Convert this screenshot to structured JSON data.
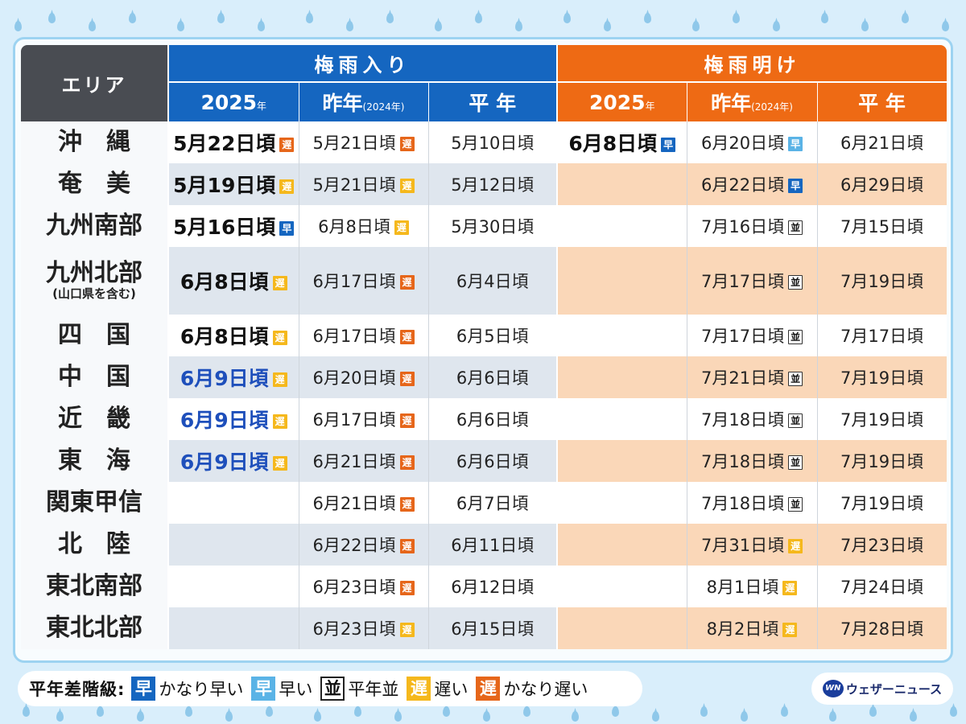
{
  "header": {
    "area": "エリア",
    "entry_label": "梅雨入り",
    "exit_label": "梅雨明け",
    "year_main": "2025",
    "year_suffix": "年",
    "last_year": "昨年",
    "last_year_paren": "(2024年)",
    "normal": "平 年"
  },
  "rows": [
    {
      "area": "沖　縄",
      "area_sub": "",
      "in_2025": "5月22日頃",
      "in_2025_badge": "遅",
      "in_2025_badge_class": "b-ka-oso",
      "in_2025_color": "black",
      "in_2024": "5月21日頃",
      "in_2024_badge": "遅",
      "in_2024_badge_class": "b-ka-oso",
      "in_normal": "5月10日頃",
      "out_2025": "6月8日頃",
      "out_2025_badge": "早",
      "out_2025_badge_class": "b-ka-haya",
      "out_2024": "6月20日頃",
      "out_2024_badge": "早",
      "out_2024_badge_class": "b-haya",
      "out_normal": "6月21日頃"
    },
    {
      "area": "奄　美",
      "area_sub": "",
      "in_2025": "5月19日頃",
      "in_2025_badge": "遅",
      "in_2025_badge_class": "b-oso",
      "in_2025_color": "black",
      "in_2024": "5月21日頃",
      "in_2024_badge": "遅",
      "in_2024_badge_class": "b-oso",
      "in_normal": "5月12日頃",
      "out_2025": "",
      "out_2025_badge": "",
      "out_2025_badge_class": "",
      "out_2024": "6月22日頃",
      "out_2024_badge": "早",
      "out_2024_badge_class": "b-ka-haya",
      "out_normal": "6月29日頃"
    },
    {
      "area": "九州南部",
      "area_sub": "",
      "in_2025": "5月16日頃",
      "in_2025_badge": "早",
      "in_2025_badge_class": "b-ka-haya",
      "in_2025_color": "black",
      "in_2024": "6月8日頃",
      "in_2024_badge": "遅",
      "in_2024_badge_class": "b-oso",
      "in_normal": "5月30日頃",
      "out_2025": "",
      "out_2025_badge": "",
      "out_2025_badge_class": "",
      "out_2024": "7月16日頃",
      "out_2024_badge": "並",
      "out_2024_badge_class": "b-nami",
      "out_normal": "7月15日頃"
    },
    {
      "area": "九州北部",
      "area_sub": "(山口県を含む)",
      "in_2025": "6月8日頃",
      "in_2025_badge": "遅",
      "in_2025_badge_class": "b-oso",
      "in_2025_color": "black",
      "in_2024": "6月17日頃",
      "in_2024_badge": "遅",
      "in_2024_badge_class": "b-ka-oso",
      "in_normal": "6月4日頃",
      "out_2025": "",
      "out_2025_badge": "",
      "out_2025_badge_class": "",
      "out_2024": "7月17日頃",
      "out_2024_badge": "並",
      "out_2024_badge_class": "b-nami",
      "out_normal": "7月19日頃"
    },
    {
      "area": "四　国",
      "area_sub": "",
      "in_2025": "6月8日頃",
      "in_2025_badge": "遅",
      "in_2025_badge_class": "b-oso",
      "in_2025_color": "black",
      "in_2024": "6月17日頃",
      "in_2024_badge": "遅",
      "in_2024_badge_class": "b-ka-oso",
      "in_normal": "6月5日頃",
      "out_2025": "",
      "out_2025_badge": "",
      "out_2025_badge_class": "",
      "out_2024": "7月17日頃",
      "out_2024_badge": "並",
      "out_2024_badge_class": "b-nami",
      "out_normal": "7月17日頃"
    },
    {
      "area": "中　国",
      "area_sub": "",
      "in_2025": "6月9日頃",
      "in_2025_badge": "遅",
      "in_2025_badge_class": "b-oso",
      "in_2025_color": "blue",
      "in_2024": "6月20日頃",
      "in_2024_badge": "遅",
      "in_2024_badge_class": "b-ka-oso",
      "in_normal": "6月6日頃",
      "out_2025": "",
      "out_2025_badge": "",
      "out_2025_badge_class": "",
      "out_2024": "7月21日頃",
      "out_2024_badge": "並",
      "out_2024_badge_class": "b-nami",
      "out_normal": "7月19日頃"
    },
    {
      "area": "近　畿",
      "area_sub": "",
      "in_2025": "6月9日頃",
      "in_2025_badge": "遅",
      "in_2025_badge_class": "b-oso",
      "in_2025_color": "blue",
      "in_2024": "6月17日頃",
      "in_2024_badge": "遅",
      "in_2024_badge_class": "b-ka-oso",
      "in_normal": "6月6日頃",
      "out_2025": "",
      "out_2025_badge": "",
      "out_2025_badge_class": "",
      "out_2024": "7月18日頃",
      "out_2024_badge": "並",
      "out_2024_badge_class": "b-nami",
      "out_normal": "7月19日頃"
    },
    {
      "area": "東　海",
      "area_sub": "",
      "in_2025": "6月9日頃",
      "in_2025_badge": "遅",
      "in_2025_badge_class": "b-oso",
      "in_2025_color": "blue",
      "in_2024": "6月21日頃",
      "in_2024_badge": "遅",
      "in_2024_badge_class": "b-ka-oso",
      "in_normal": "6月6日頃",
      "out_2025": "",
      "out_2025_badge": "",
      "out_2025_badge_class": "",
      "out_2024": "7月18日頃",
      "out_2024_badge": "並",
      "out_2024_badge_class": "b-nami",
      "out_normal": "7月19日頃"
    },
    {
      "area": "関東甲信",
      "area_sub": "",
      "in_2025": "",
      "in_2025_badge": "",
      "in_2025_badge_class": "",
      "in_2025_color": "black",
      "in_2024": "6月21日頃",
      "in_2024_badge": "遅",
      "in_2024_badge_class": "b-ka-oso",
      "in_normal": "6月7日頃",
      "out_2025": "",
      "out_2025_badge": "",
      "out_2025_badge_class": "",
      "out_2024": "7月18日頃",
      "out_2024_badge": "並",
      "out_2024_badge_class": "b-nami",
      "out_normal": "7月19日頃"
    },
    {
      "area": "北　陸",
      "area_sub": "",
      "in_2025": "",
      "in_2025_badge": "",
      "in_2025_badge_class": "",
      "in_2025_color": "black",
      "in_2024": "6月22日頃",
      "in_2024_badge": "遅",
      "in_2024_badge_class": "b-ka-oso",
      "in_normal": "6月11日頃",
      "out_2025": "",
      "out_2025_badge": "",
      "out_2025_badge_class": "",
      "out_2024": "7月31日頃",
      "out_2024_badge": "遅",
      "out_2024_badge_class": "b-oso",
      "out_normal": "7月23日頃"
    },
    {
      "area": "東北南部",
      "area_sub": "",
      "in_2025": "",
      "in_2025_badge": "",
      "in_2025_badge_class": "",
      "in_2025_color": "black",
      "in_2024": "6月23日頃",
      "in_2024_badge": "遅",
      "in_2024_badge_class": "b-ka-oso",
      "in_normal": "6月12日頃",
      "out_2025": "",
      "out_2025_badge": "",
      "out_2025_badge_class": "",
      "out_2024": "8月1日頃",
      "out_2024_badge": "遅",
      "out_2024_badge_class": "b-oso",
      "out_normal": "7月24日頃"
    },
    {
      "area": "東北北部",
      "area_sub": "",
      "in_2025": "",
      "in_2025_badge": "",
      "in_2025_badge_class": "",
      "in_2025_color": "black",
      "in_2024": "6月23日頃",
      "in_2024_badge": "遅",
      "in_2024_badge_class": "b-oso",
      "in_normal": "6月15日頃",
      "out_2025": "",
      "out_2025_badge": "",
      "out_2025_badge_class": "",
      "out_2024": "8月2日頃",
      "out_2024_badge": "遅",
      "out_2024_badge_class": "b-oso",
      "out_normal": "7月28日頃"
    }
  ],
  "legend": {
    "title": "平年差階級:",
    "items": [
      {
        "badge": "早",
        "label": "かなり早い",
        "color": "#1566c0"
      },
      {
        "badge": "早",
        "label": "早い",
        "color": "#5ab3e6"
      },
      {
        "badge": "並",
        "label": "平年並",
        "color": "#ffffff"
      },
      {
        "badge": "遅",
        "label": "遅い",
        "color": "#f5b81c"
      },
      {
        "badge": "遅",
        "label": "かなり遅い",
        "color": "#e6661a"
      }
    ]
  },
  "brand": {
    "logo": "WN",
    "name": "ウェザーニュース"
  },
  "colors": {
    "entry_header": "#1566c0",
    "exit_header": "#ee6a14",
    "area_header": "#494c52",
    "entry_shade": "#dfe6ee",
    "exit_shade": "#fad7b8",
    "highlight_text": "#1e4fbb"
  }
}
